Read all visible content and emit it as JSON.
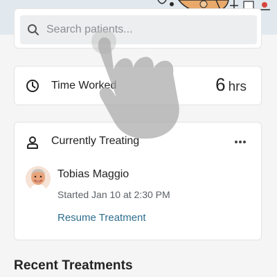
{
  "search": {
    "placeholder": "Search patients..."
  },
  "time_worked": {
    "label": "Time Worked",
    "value": "6",
    "unit": "hrs"
  },
  "currently_treating": {
    "title": "Currently Treating",
    "patient": {
      "name": "Tobias Maggio",
      "started": "Started Jan 10 at 2:30 PM"
    },
    "action_label": "Resume Treatment"
  },
  "recent_treatments": {
    "heading": "Recent Treatments"
  },
  "icons": {
    "search": "search-icon",
    "clock": "clock-icon",
    "person": "person-icon",
    "more": "more-icon",
    "tap_gesture": "hand-pointer-icon"
  },
  "colors": {
    "link": "#2e6e8e",
    "header_background": "#e2e9ee",
    "page_background": "#f5f5f5"
  }
}
